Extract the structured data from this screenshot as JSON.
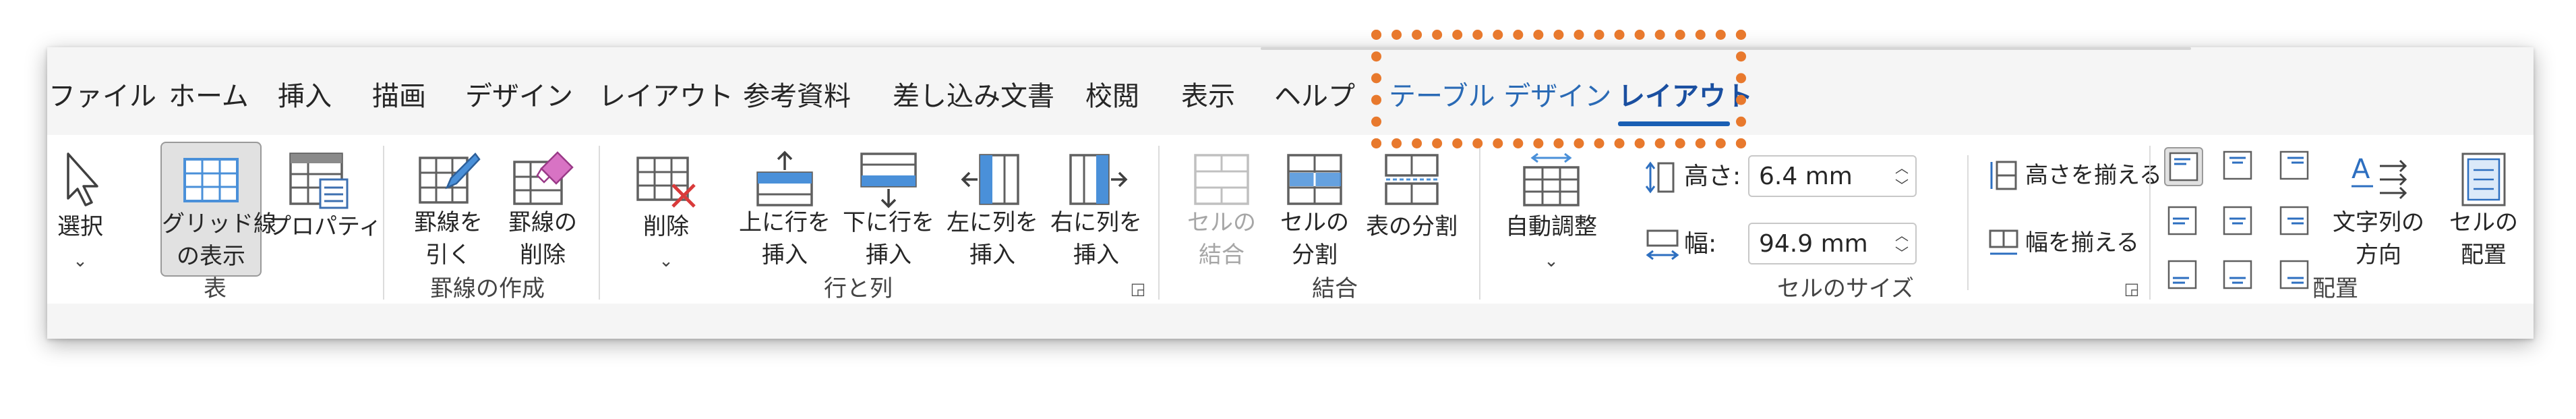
{
  "tabs": [
    "ファイル",
    "ホーム",
    "挿入",
    "描画",
    "デザイン",
    "レイアウト",
    "参考資料",
    "差し込み文書",
    "校閲",
    "表示",
    "ヘルプ",
    "テーブル デザイン",
    "レイアウト"
  ],
  "groups": {
    "table": {
      "label": "表",
      "select": "選択",
      "gridlines": [
        "グリッド線",
        "の表示"
      ],
      "properties": "プロパティ"
    },
    "draw": {
      "label": "罫線の作成",
      "draw_table": [
        "罫線を",
        "引く"
      ],
      "eraser": [
        "罫線の",
        "削除"
      ]
    },
    "rows_columns": {
      "label": "行と列",
      "delete": "削除",
      "insert_above": [
        "上に行を",
        "挿入"
      ],
      "insert_below": [
        "下に行を",
        "挿入"
      ],
      "insert_left": [
        "左に列を",
        "挿入"
      ],
      "insert_right": [
        "右に列を",
        "挿入"
      ]
    },
    "merge": {
      "label": "結合",
      "merge_cells": [
        "セルの",
        "結合"
      ],
      "split_cells": [
        "セルの",
        "分割"
      ],
      "split_table": "表の分割"
    },
    "cell_size": {
      "label": "セルのサイズ",
      "autofit": "自動調整",
      "height_label": "高さ:",
      "height_value": "6.4 mm",
      "width_label": "幅:",
      "width_value": "94.9 mm",
      "distribute_rows": "高さを揃える",
      "distribute_columns": "幅を揃える"
    },
    "alignment": {
      "label": "配置",
      "text_direction": [
        "文字列の",
        "方向"
      ],
      "cell_margins": [
        "セルの",
        "配置"
      ]
    }
  },
  "colors": {
    "accent": "#1a5fb4",
    "callout": "#e8792d",
    "icon_blue": "#4a90d9",
    "icon_gray": "#606060",
    "disabled": "#a6a6a6",
    "delete_red": "#d93a3a"
  }
}
